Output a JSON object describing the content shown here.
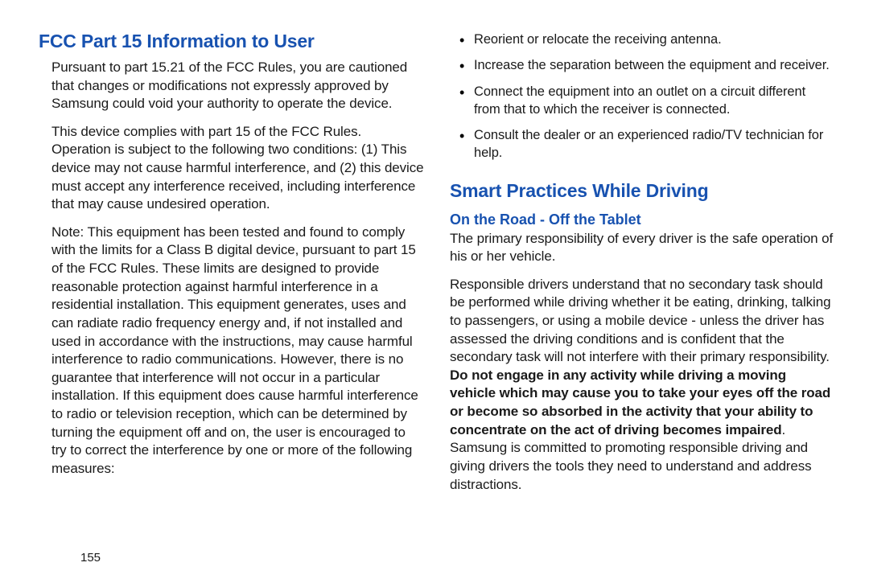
{
  "left": {
    "heading": "FCC Part 15 Information to User",
    "para1": "Pursuant to part 15.21 of the FCC Rules, you are cautioned that changes or modifications not expressly approved by Samsung could void your authority to operate the device.",
    "para2": "This device complies with part 15 of the FCC Rules. Operation is subject to the following two conditions: (1) This device may not cause harmful interference, and (2) this device must accept any interference received, including interference that may cause undesired operation.",
    "para3": "Note: This equipment has been tested and found to comply with the limits for a Class B digital device, pursuant to part 15 of the FCC Rules. These limits are designed to provide reasonable protection against harmful interference in a residential installation. This equipment generates, uses and can radiate radio frequency energy and, if not installed and used in accordance with the instructions, may cause harmful interference to radio communications. However, there is no guarantee that interference will not occur in a particular installation. If this equipment does cause harmful interference to radio or television reception, which can be determined by turning the equipment off and on, the user is encouraged to try to correct the interference by one or more of the following measures:"
  },
  "right": {
    "bullets": [
      "Reorient or relocate the receiving antenna.",
      "Increase the separation between the equipment and receiver.",
      "Connect the equipment into an outlet on a circuit different from that to which the receiver is connected.",
      "Consult the dealer or an experienced radio/TV technician for help."
    ],
    "heading2": "Smart Practices While Driving",
    "subheading": "On the Road - Off the Tablet",
    "para1": "The primary responsibility of every driver is the safe operation of his or her vehicle.",
    "para2a": "Responsible drivers understand that no secondary task should be performed while driving whether it be eating, drinking, talking to passengers, or using a mobile device - unless the driver has assessed the driving conditions and is confident that the secondary task will not interfere with their primary responsibility. ",
    "para2b": "Do not engage in any activity while driving a moving vehicle which may cause you to take your eyes off the road or become so absorbed in the activity that your ability to concentrate on the act of driving becomes impaired",
    "para2c": ". Samsung is committed to promoting responsible driving and giving drivers the tools they need to understand and address distractions."
  },
  "page_number": "155"
}
